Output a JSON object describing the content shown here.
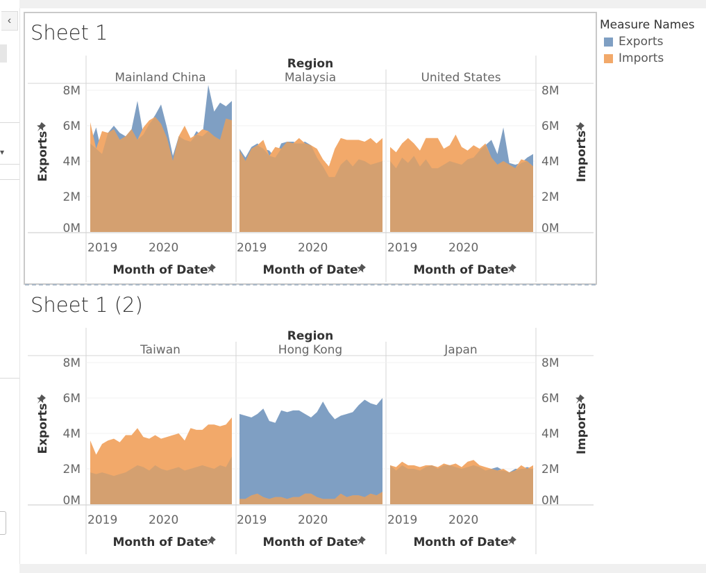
{
  "ui": {
    "collapse_glyph": "‹",
    "dropdown_glyph": "▾",
    "pin_icon": "pin-icon",
    "legend": {
      "title": "Measure Names",
      "items": [
        {
          "label": "Exports",
          "color": "#7f9fc3"
        },
        {
          "label": "Imports",
          "color": "#f2a96a"
        }
      ]
    },
    "colors": {
      "exports": "#7f9fc3",
      "imports": "#f2a96a",
      "overlap": "#d4a070"
    }
  },
  "chart_data": [
    {
      "type": "area",
      "title": "Sheet 1",
      "column_header": "Region",
      "ylabel_left": "Exports",
      "ylabel_right": "Imports",
      "xlabel": "Month of Date",
      "y_ticks": [
        "8M",
        "6M",
        "4M",
        "2M",
        "0M"
      ],
      "ylim": [
        0,
        8000000
      ],
      "x_ticks": [
        "2019",
        "2020"
      ],
      "panels": [
        {
          "region": "Mainland China",
          "series": [
            {
              "name": "Exports",
              "values": [
                5.0,
                5.9,
                4.4,
                5.6,
                6.0,
                5.6,
                5.4,
                5.8,
                7.4,
                5.5,
                6.1,
                6.6,
                7.2,
                5.9,
                4.3,
                5.4,
                5.2,
                5.1,
                5.7,
                5.4,
                8.3,
                6.8,
                7.3,
                7.1,
                7.4
              ]
            },
            {
              "name": "Imports",
              "values": [
                6.2,
                4.7,
                5.7,
                5.6,
                5.8,
                5.2,
                5.4,
                5.8,
                5.2,
                5.9,
                6.3,
                6.5,
                6.1,
                5.3,
                4.0,
                5.4,
                6.0,
                5.3,
                5.5,
                5.8,
                5.7,
                5.4,
                5.2,
                6.4,
                6.3
              ]
            }
          ]
        },
        {
          "region": "Malaysia",
          "series": [
            {
              "name": "Exports",
              "values": [
                4.7,
                4.2,
                4.8,
                5.0,
                4.7,
                4.6,
                4.2,
                5.0,
                5.1,
                5.1,
                5.0,
                5.1,
                4.9,
                4.2,
                3.7,
                3.1,
                3.1,
                3.8,
                4.1,
                3.7,
                4.1,
                4.0,
                3.8,
                3.9,
                4.0
              ]
            },
            {
              "name": "Imports",
              "values": [
                4.6,
                4.0,
                4.7,
                4.9,
                5.2,
                4.3,
                4.8,
                4.7,
                5.1,
                5.0,
                5.3,
                5.0,
                4.9,
                4.7,
                4.1,
                3.7,
                4.7,
                5.3,
                5.2,
                5.2,
                5.2,
                5.1,
                5.3,
                5.0,
                5.3
              ]
            }
          ]
        },
        {
          "region": "United States",
          "series": [
            {
              "name": "Exports",
              "values": [
                4.0,
                3.6,
                4.2,
                3.9,
                4.3,
                3.7,
                4.1,
                3.6,
                3.6,
                3.8,
                4.0,
                3.9,
                3.8,
                4.1,
                4.2,
                4.6,
                4.9,
                5.2,
                4.4,
                5.9,
                3.9,
                3.8,
                3.9,
                4.2,
                4.4
              ]
            },
            {
              "name": "Imports",
              "values": [
                4.8,
                4.5,
                5.0,
                5.3,
                5.0,
                4.6,
                5.3,
                5.3,
                5.3,
                4.7,
                4.9,
                5.5,
                4.8,
                4.6,
                4.9,
                4.7,
                5.0,
                4.2,
                3.8,
                4.0,
                3.8,
                3.6,
                4.1,
                4.0,
                3.7
              ]
            }
          ]
        }
      ]
    },
    {
      "type": "area",
      "title": "Sheet 1 (2)",
      "column_header": "Region",
      "ylabel_left": "Exports",
      "ylabel_right": "Imports",
      "xlabel": "Month of Date",
      "y_ticks": [
        "8M",
        "6M",
        "4M",
        "2M",
        "0M"
      ],
      "ylim": [
        0,
        8000000
      ],
      "x_ticks": [
        "2019",
        "2020"
      ],
      "panels": [
        {
          "region": "Taiwan",
          "series": [
            {
              "name": "Exports",
              "values": [
                1.8,
                1.7,
                1.8,
                1.7,
                1.6,
                1.7,
                1.8,
                2.0,
                2.2,
                2.1,
                1.9,
                2.2,
                2.0,
                1.9,
                2.0,
                2.1,
                1.9,
                2.0,
                2.1,
                2.2,
                2.1,
                2.0,
                2.2,
                2.1,
                2.7
              ]
            },
            {
              "name": "Imports",
              "values": [
                3.6,
                2.8,
                3.4,
                3.6,
                3.7,
                3.5,
                3.9,
                3.9,
                4.3,
                3.8,
                3.7,
                3.9,
                3.7,
                3.8,
                3.9,
                4.0,
                3.6,
                4.3,
                4.2,
                4.2,
                4.5,
                4.5,
                4.4,
                4.5,
                4.9
              ]
            }
          ]
        },
        {
          "region": "Hong Kong",
          "series": [
            {
              "name": "Exports",
              "values": [
                5.1,
                5.0,
                4.9,
                5.1,
                5.4,
                4.7,
                4.6,
                5.3,
                5.2,
                5.3,
                5.3,
                5.1,
                4.9,
                5.2,
                5.8,
                5.2,
                4.8,
                5.0,
                5.1,
                5.2,
                5.6,
                5.9,
                5.7,
                5.6,
                6.0
              ]
            },
            {
              "name": "Imports",
              "values": [
                0.3,
                0.3,
                0.5,
                0.6,
                0.4,
                0.3,
                0.4,
                0.4,
                0.3,
                0.4,
                0.4,
                0.6,
                0.6,
                0.4,
                0.3,
                0.3,
                0.3,
                0.6,
                0.4,
                0.5,
                0.5,
                0.4,
                0.6,
                0.5,
                0.7
              ]
            }
          ]
        },
        {
          "region": "Japan",
          "series": [
            {
              "name": "Exports",
              "values": [
                2.2,
                1.9,
                2.2,
                2.0,
                2.0,
                1.9,
                2.1,
                2.2,
                2.0,
                2.2,
                2.2,
                2.1,
                2.0,
                2.1,
                2.2,
                2.1,
                1.9,
                2.0,
                2.1,
                1.9,
                1.8,
                2.0,
                2.0,
                2.1,
                2.0
              ]
            },
            {
              "name": "Imports",
              "values": [
                2.2,
                2.1,
                2.4,
                2.2,
                2.2,
                2.1,
                2.2,
                2.2,
                2.1,
                2.3,
                2.2,
                2.3,
                2.1,
                2.4,
                2.5,
                2.2,
                2.1,
                2.0,
                1.9,
                2.0,
                1.8,
                1.9,
                2.2,
                2.0,
                2.2
              ]
            }
          ]
        }
      ]
    }
  ]
}
